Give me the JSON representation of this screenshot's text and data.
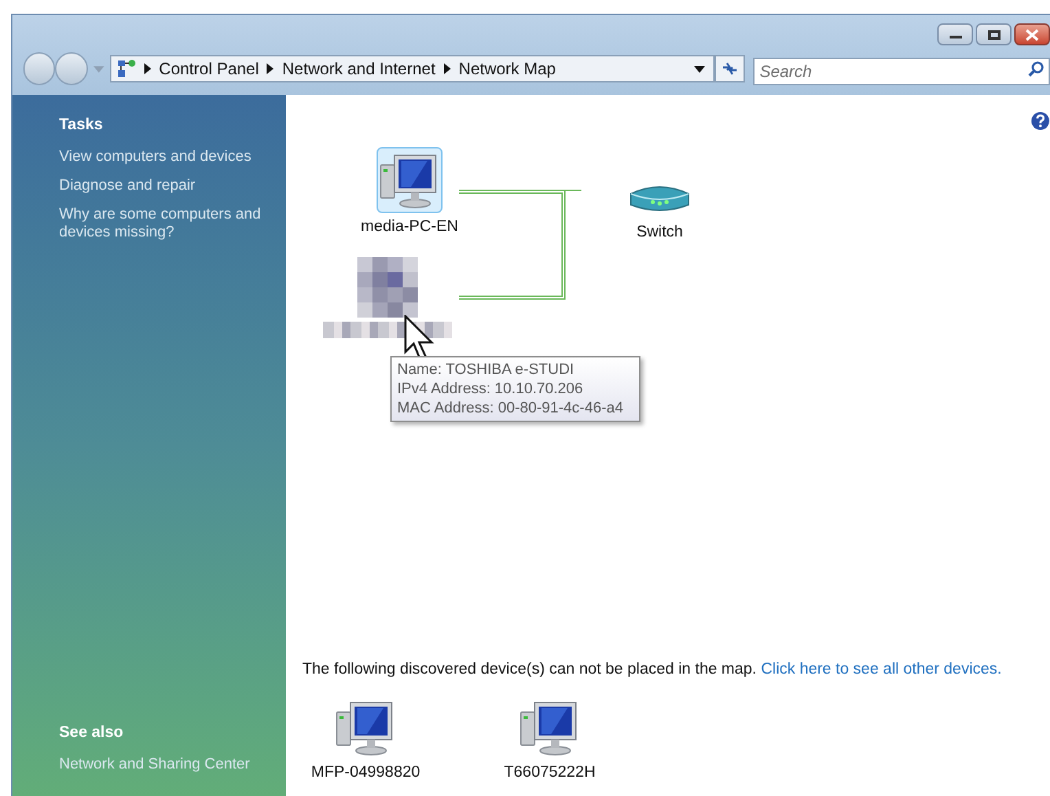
{
  "address_bar": {
    "breadcrumb": [
      "Control Panel",
      "Network and Internet",
      "Network Map"
    ],
    "search": {
      "placeholder": "Search"
    }
  },
  "sidebar": {
    "sections": [
      {
        "heading": "Tasks",
        "links": [
          "View computers and devices",
          "Diagnose and repair",
          "Why are some computers and devices missing?"
        ]
      },
      {
        "heading": "See also",
        "links": [
          "Network and Sharing Center"
        ]
      }
    ]
  },
  "map": {
    "nodes": [
      {
        "kind": "computer",
        "label": "media-PC-EN",
        "selected": true
      },
      {
        "kind": "switch",
        "label": "Switch",
        "selected": false
      },
      {
        "kind": "obscured",
        "selected": false
      }
    ],
    "tooltip": [
      "Name: TOSHIBA e-STUDI",
      "IPv4 Address: 10.10.70.206",
      "MAC Address: 00-80-91-4c-46-a4"
    ]
  },
  "unplaced": {
    "notice": "The following discovered device(s) can not be placed in the map.",
    "link": "Click here to see all other devices.",
    "devices": [
      {
        "label": "MFP-04998820"
      },
      {
        "label": "T66075222H"
      }
    ]
  }
}
